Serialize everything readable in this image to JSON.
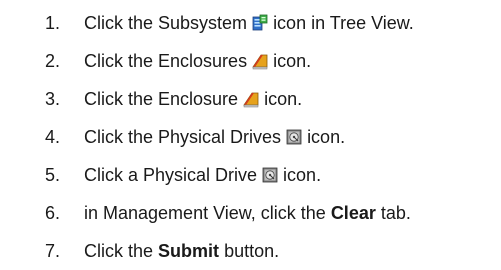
{
  "steps": [
    {
      "number": "1.",
      "before": "Click the Subsystem",
      "icon": "subsystem-icon",
      "after": "icon in Tree View."
    },
    {
      "number": "2.",
      "before": "Click the Enclosures",
      "icon": "enclosures-icon",
      "after": "icon."
    },
    {
      "number": "3.",
      "before": "Click the Enclosure",
      "icon": "enclosure-icon",
      "after": "icon."
    },
    {
      "number": "4.",
      "before": "Click the Physical Drives",
      "icon": "physical-drives-icon",
      "after": "icon."
    },
    {
      "number": "5.",
      "before": "Click a Physical Drive",
      "icon": "physical-drive-icon",
      "after": "icon."
    },
    {
      "number": "6.",
      "before": "in Management View, click the",
      "bold": "Clear",
      "after": "tab."
    },
    {
      "number": "7.",
      "before": "Click the",
      "bold": "Submit",
      "after": "button."
    }
  ]
}
